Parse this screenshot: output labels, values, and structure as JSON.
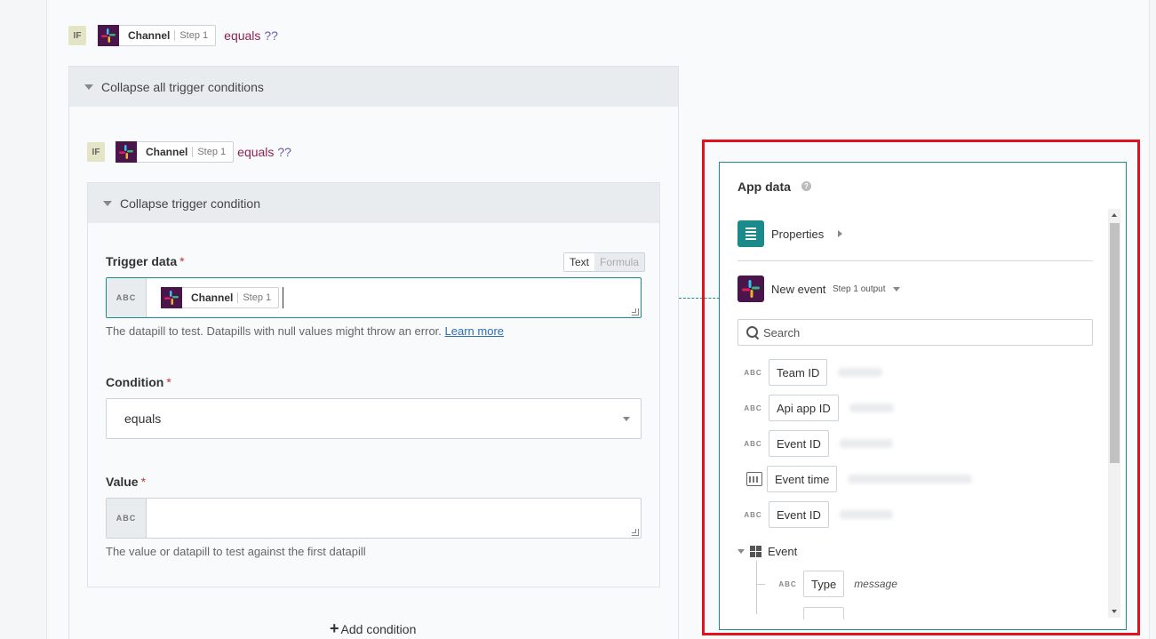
{
  "condition_row": {
    "badge": "IF",
    "pill_name": "Channel",
    "pill_step": "Step 1",
    "operator": "equals",
    "operand": "??"
  },
  "panel": {
    "collapse_all_label": "Collapse all trigger conditions"
  },
  "inner_condition_row": {
    "badge": "IF",
    "pill_name": "Channel",
    "pill_step": "Step 1",
    "operator": "equals",
    "operand": "??"
  },
  "inner": {
    "collapse_label": "Collapse trigger condition",
    "trigger_data": {
      "label": "Trigger data",
      "required_mark": "*",
      "type_tag": "ABC",
      "toggle_text": "Text",
      "toggle_formula": "Formula",
      "pill_name": "Channel",
      "pill_step": "Step 1",
      "help_text": "The datapill to test. Datapills with null values might throw an error.",
      "help_link": "Learn more"
    },
    "condition": {
      "label": "Condition",
      "required_mark": "*",
      "selected": "equals"
    },
    "value": {
      "label": "Value",
      "required_mark": "*",
      "type_tag": "ABC",
      "help_text": "The value or datapill to test against the first datapill"
    }
  },
  "add_condition_label": "Add condition",
  "app_data": {
    "title": "App data",
    "help_icon": "?",
    "properties_label": "Properties",
    "new_event_label": "New event",
    "new_event_step": "Step 1 output",
    "search_placeholder": "Search",
    "datapills": [
      {
        "type": "ABC",
        "label": "Team ID"
      },
      {
        "type": "ABC",
        "label": "Api app ID"
      },
      {
        "type": "ABC",
        "label": "Event ID"
      },
      {
        "type": "calendar-icon",
        "label": "Event time"
      },
      {
        "type": "ABC",
        "label": "Event ID"
      }
    ],
    "event_node": {
      "label": "Event",
      "children": [
        {
          "type": "ABC",
          "label": "Type",
          "value": "message"
        }
      ]
    }
  },
  "colors": {
    "accent": "#1a8a8a",
    "highlight_frame": "#e0141e",
    "operator": "#8a2255"
  }
}
